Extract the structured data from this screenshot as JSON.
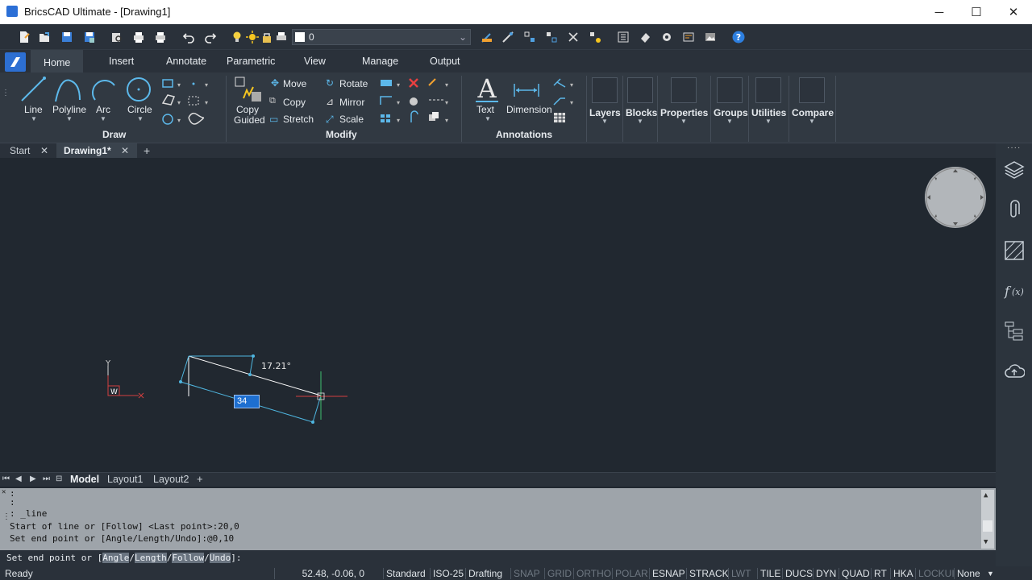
{
  "window": {
    "title": "BricsCAD Ultimate - [Drawing1]"
  },
  "layer_select": {
    "value": "0"
  },
  "ribbon_tabs": [
    "Home",
    "Insert",
    "Annotate",
    "Parametric",
    "View",
    "Manage",
    "Output"
  ],
  "draw": {
    "line": "Line",
    "polyline": "Polyline",
    "arc": "Arc",
    "circle": "Circle",
    "panel": "Draw"
  },
  "modify": {
    "copy_guided_1": "Copy",
    "copy_guided_2": "Guided",
    "move": "Move",
    "copy": "Copy",
    "stretch": "Stretch",
    "rotate": "Rotate",
    "mirror": "Mirror",
    "scale": "Scale",
    "panel": "Modify"
  },
  "annotations": {
    "text": "Text",
    "dimension": "Dimension",
    "panel": "Annotations"
  },
  "panels": {
    "layers": "Layers",
    "blocks": "Blocks",
    "properties": "Properties",
    "groups": "Groups",
    "utilities": "Utilities",
    "compare": "Compare"
  },
  "doc_tabs": {
    "start": "Start",
    "drawing": "Drawing1*",
    "add": "+"
  },
  "canvas": {
    "angle_label": "17.21°",
    "length_input": "34",
    "ucs_y": "Y",
    "ucs_w": "W"
  },
  "layout_tabs": {
    "model": "Model",
    "layout1": "Layout1",
    "layout2": "Layout2",
    "add": "+"
  },
  "command_history": [
    ":",
    ":",
    ": _line",
    "Start of line or [Follow] <Last point>:20,0",
    "Set end point or [Angle/Length/Undo]:@0,10"
  ],
  "command_line": {
    "prefix": "Set end point or [",
    "opt1": "Angle",
    "opt2": "Length",
    "opt3": "Follow",
    "opt4": "Undo",
    "suffix": "]:",
    "s1": "/",
    "s2": "/",
    "s3": "/"
  },
  "status": {
    "ready": "Ready",
    "coords": "52.48, -0.06, 0",
    "style": "Standard",
    "dimstyle": "ISO-25",
    "workspace": "Drafting",
    "toggles": [
      {
        "label": "SNAP",
        "on": false
      },
      {
        "label": "GRID",
        "on": false
      },
      {
        "label": "ORTHO",
        "on": false
      },
      {
        "label": "POLAR",
        "on": false
      },
      {
        "label": "ESNAP",
        "on": true
      },
      {
        "label": "STRACK",
        "on": true
      },
      {
        "label": "LWT",
        "on": false
      },
      {
        "label": "TILE",
        "on": true
      },
      {
        "label": "DUCS",
        "on": true
      },
      {
        "label": "DYN",
        "on": true
      },
      {
        "label": "QUAD",
        "on": true
      },
      {
        "label": "RT",
        "on": true
      },
      {
        "label": "HKA",
        "on": true
      },
      {
        "label": "LOCKUI",
        "on": false
      }
    ],
    "selection": "None"
  },
  "colors": {
    "accent": "#2b6fd6",
    "canvas": "#212830",
    "entity": "#4fb6e0",
    "dim_input": "#1e6fd0"
  }
}
